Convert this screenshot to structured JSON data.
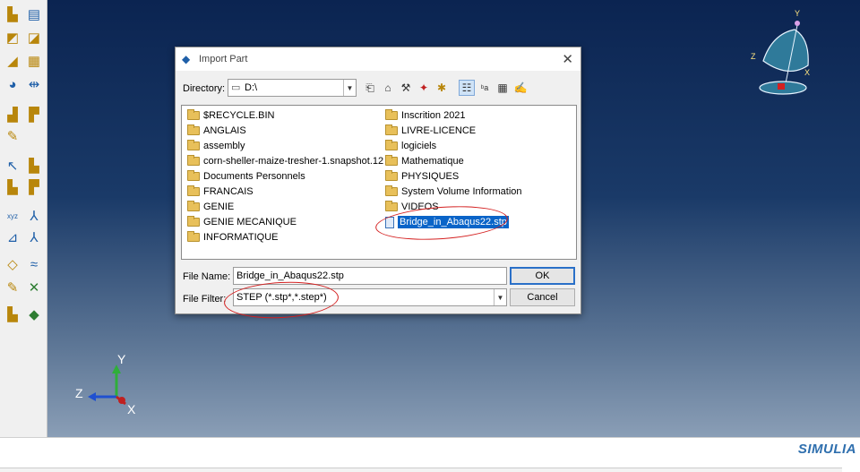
{
  "dialog": {
    "title": "Import Part",
    "directory_label": "Directory:",
    "directory_value": "D:\\",
    "file_name_label": "File Name:",
    "file_name_value": "Bridge_in_Abaqus22.stp",
    "file_filter_label": "File Filter:",
    "file_filter_value": "STEP (*.stp*,*.step*)",
    "ok_label": "OK",
    "cancel_label": "Cancel"
  },
  "files": {
    "left": [
      "$RECYCLE.BIN",
      "ANGLAIS",
      "assembly",
      "corn-sheller-maize-tresher-1.snapshot.12",
      "Documents Personnels",
      "FRANCAIS",
      "GENIE",
      "GENIE MECANIQUE",
      "INFORMATIQUE"
    ],
    "right": [
      "Inscrition 2021",
      "LIVRE-LICENCE",
      "logiciels",
      "Mathematique",
      "PHYSIQUES",
      "System Volume Information",
      "VIDEOS"
    ],
    "selected_file": "Bridge_in_Abaqus22.stp"
  },
  "triad": {
    "x": "X",
    "y": "Y",
    "z": "Z"
  },
  "viewcube": {
    "x": "X",
    "y": "Y",
    "z": "Z"
  },
  "branding": {
    "logo": "SIMULIA"
  },
  "colors": {
    "selection": "#0a64c8",
    "annotation": "#d42020",
    "viewport_top": "#0b2451"
  }
}
